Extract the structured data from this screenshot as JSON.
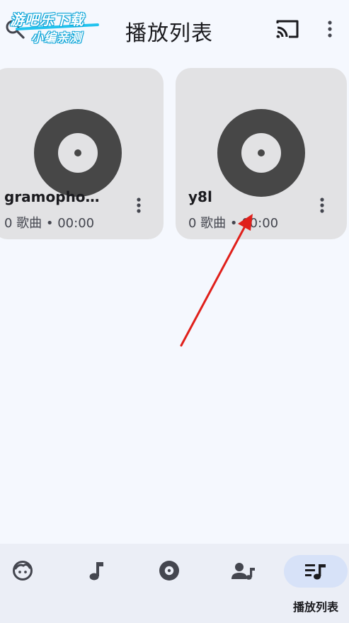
{
  "app": {
    "title": "播放列表",
    "watermark": {
      "line1": "游吧乐下载",
      "line2": "小编亲测"
    }
  },
  "playlists": [
    {
      "title": "gramopho…",
      "subtitle": "0 歌曲 • 00:00"
    },
    {
      "title": "y8l",
      "subtitle": "0 歌曲 • 00:00"
    }
  ],
  "bottom_nav": {
    "items": [
      {
        "icon": "face-icon",
        "label": ""
      },
      {
        "icon": "music-note-icon",
        "label": ""
      },
      {
        "icon": "album-icon",
        "label": ""
      },
      {
        "icon": "artist-icon",
        "label": ""
      },
      {
        "icon": "playlist-icon",
        "label": "播放列表",
        "active": true
      }
    ]
  },
  "colors": {
    "background": "#f5f8fe",
    "card": "#e2e2e4",
    "disc": "#474747",
    "nav_bar": "#ebeef6",
    "nav_active_pill": "#d7e2f8",
    "annotation_arrow": "#e0201b"
  }
}
